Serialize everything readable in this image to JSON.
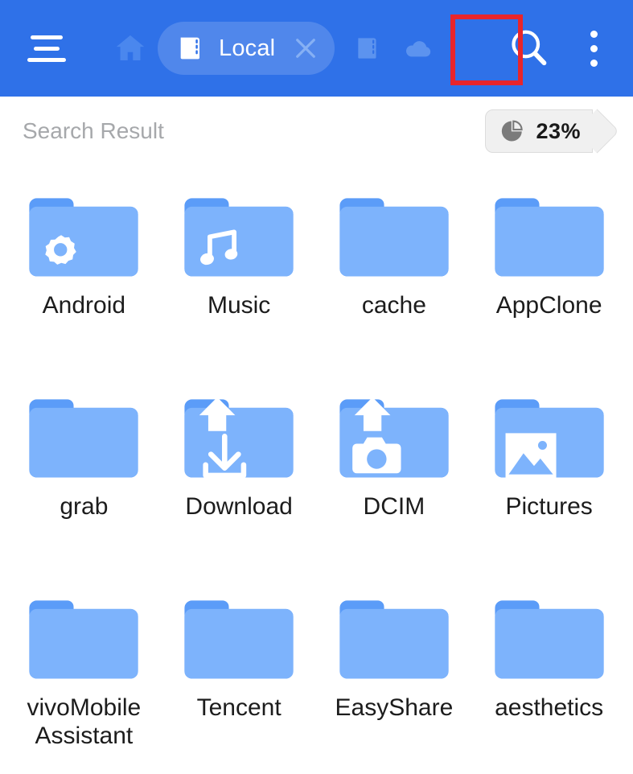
{
  "appbar": {
    "menu_label": "menu",
    "home_label": "home",
    "tab": {
      "label": "Local",
      "icon": "sd-card-icon",
      "close_label": "close"
    },
    "storage_icons": [
      "sd-card-icon",
      "cloud-icon"
    ],
    "search_label": "search",
    "more_label": "more options",
    "bg_color": "#2F71E8",
    "highlight_color": "#E8252B"
  },
  "subheader": {
    "title": "Search Result",
    "badge": {
      "icon": "pie-chart-icon",
      "value": "23%"
    }
  },
  "grid": {
    "items": [
      {
        "label": "Android",
        "icon": "gear-icon",
        "badge": "none"
      },
      {
        "label": "Music",
        "icon": "music-note-icon",
        "badge": "none"
      },
      {
        "label": "cache",
        "icon": "none",
        "badge": "none"
      },
      {
        "label": "AppClone",
        "icon": "none",
        "badge": "none"
      },
      {
        "label": "grab",
        "icon": "none",
        "badge": "none"
      },
      {
        "label": "Download",
        "icon": "download-icon",
        "badge": "up-arrow-icon"
      },
      {
        "label": "DCIM",
        "icon": "camera-icon",
        "badge": "up-arrow-icon"
      },
      {
        "label": "Pictures",
        "icon": "image-icon",
        "badge": "none"
      },
      {
        "label": "vivoMobile Assistant",
        "icon": "none",
        "badge": "none"
      },
      {
        "label": "Tencent",
        "icon": "none",
        "badge": "none"
      },
      {
        "label": "EasyShare",
        "icon": "none",
        "badge": "none"
      },
      {
        "label": "aesthetics",
        "icon": "none",
        "badge": "none"
      }
    ],
    "folder_color": "#7DB3FC",
    "folder_tab_color": "#5B9CF8"
  }
}
